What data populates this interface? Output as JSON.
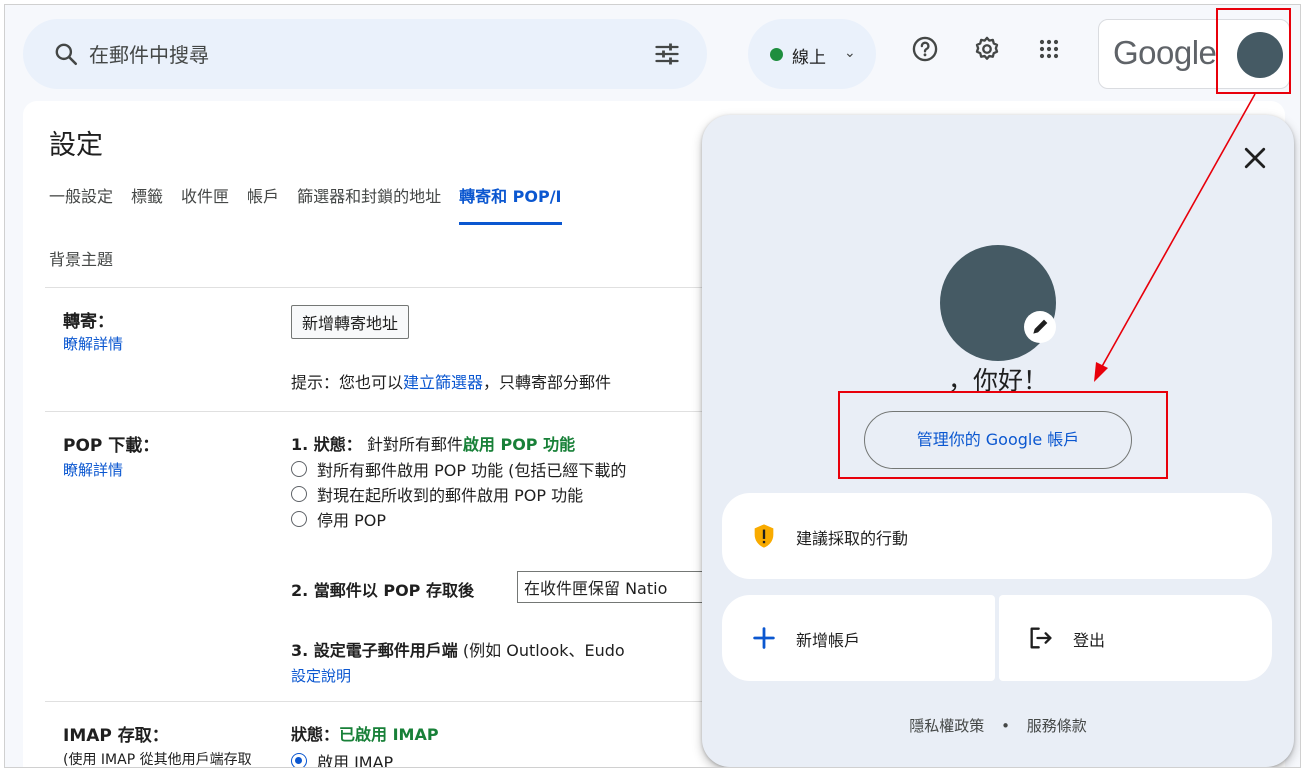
{
  "topbar": {
    "search_placeholder": "在郵件中搜尋",
    "status_label": "線上",
    "google_logo_text": "Google"
  },
  "settings": {
    "title": "設定",
    "tabs": [
      "一般設定",
      "標籤",
      "收件匣",
      "帳戶",
      "篩選器和封鎖的地址",
      "轉寄和 POP/I"
    ],
    "tab_row2": "背景主題",
    "forwarding": {
      "title": "轉寄：",
      "learn_more": "瞭解詳情",
      "add_button": "新增轉寄地址",
      "tip_prefix": "提示：您也可以",
      "tip_link": "建立篩選器",
      "tip_suffix": "，只轉寄部分郵件"
    },
    "pop": {
      "title": "POP 下載：",
      "learn_more": "瞭解詳情",
      "status_prefix": "1. 狀態：",
      "status_mid": "針對所有郵件",
      "status_value": "啟用 POP 功能",
      "options": [
        "對所有郵件啟用 POP 功能 (包括已經下載的",
        "對現在起所收到的郵件啟用 POP 功能",
        "停用 POP"
      ],
      "step2_label": "2. 當郵件以 POP 存取後",
      "step2_value": "在收件匣保留 Natio",
      "step3_label": "3. 設定電子郵件用戶端",
      "step3_suffix": "(例如 Outlook、Eudo",
      "step3_link": "設定說明"
    },
    "imap": {
      "title": "IMAP 存取：",
      "subtitle": "(使用 IMAP 從其他用戶端存取",
      "status_prefix": "狀態：",
      "status_value": "已啟用 IMAP",
      "option": "啟用 IMAP"
    }
  },
  "popup": {
    "greeting": "，你好！",
    "manage_button": "管理你的 Google 帳戶",
    "recommended_action": "建議採取的行動",
    "add_account": "新增帳戶",
    "sign_out": "登出",
    "privacy": "隱私權政策",
    "separator": "•",
    "terms": "服務條款"
  },
  "colors": {
    "accent": "#0b57d0",
    "annotation_red": "#e8000b",
    "avatar": "#455a64",
    "online_green": "#1e8e3e",
    "warning": "#f9ab00"
  }
}
